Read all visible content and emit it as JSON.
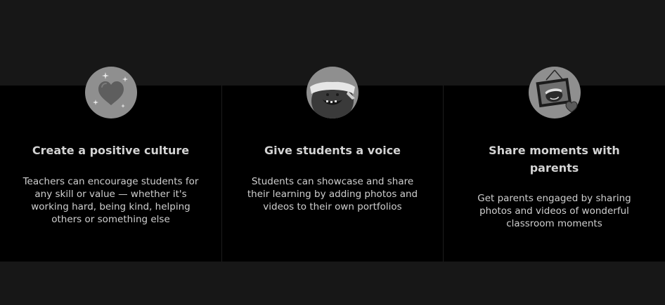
{
  "features": [
    {
      "icon": "heart-sparkle-icon",
      "title": "Create a positive culture",
      "description": "Teachers can encourage students for any skill or value — whether it's working hard, being kind, helping others or something else"
    },
    {
      "icon": "monster-headband-icon",
      "title": "Give students a voice",
      "description": "Students can showcase and share their learning by adding photos and videos to their own portfolios"
    },
    {
      "icon": "photo-frame-heart-icon",
      "title": "Share moments with parents",
      "description": "Get parents engaged by sharing photos and videos of wonderful classroom moments"
    }
  ],
  "colors": {
    "page_background": "#171717",
    "card_background": "#000000",
    "icon_circle": "#8f8f8f",
    "title_text": "#d3d3d3",
    "body_text": "#cfcfcf"
  }
}
